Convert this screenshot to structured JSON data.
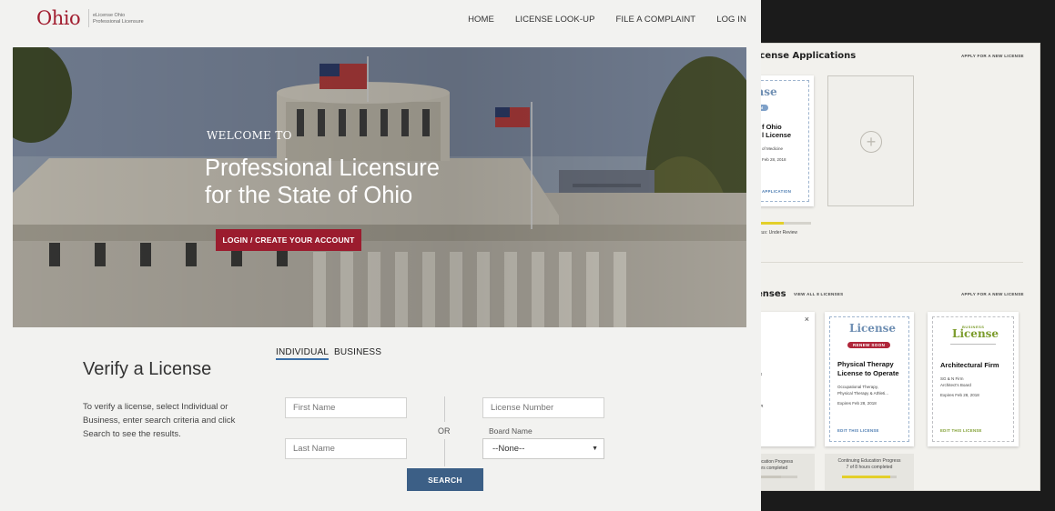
{
  "header": {
    "logo_text": "Ohio",
    "logo_sub": [
      "eLicense Ohio",
      "Professional Licensure"
    ],
    "nav": [
      "HOME",
      "LICENSE LOOK-UP",
      "FILE A COMPLAINT",
      "LOG IN"
    ]
  },
  "hero": {
    "welcome": "WELCOME TO",
    "title_line1": "Professional Licensure",
    "title_line2": "for the State of Ohio",
    "cta": "LOGIN / CREATE YOUR ACCOUNT"
  },
  "verify": {
    "title": "Verify a License",
    "description": "To verify a license, select Individual or Business, enter search criteria and click Search to see the results.",
    "tabs": [
      "INDIVIDUAL",
      "BUSINESS"
    ],
    "first_name_placeholder": "First Name",
    "last_name_placeholder": "Last Name",
    "license_number_placeholder": "License Number",
    "or": "OR",
    "board_label": "Board Name",
    "board_value": "--None--",
    "search": "SEARCH"
  },
  "dashboard": {
    "applications_title": "icense Applications",
    "apply_link": "APPLY FOR A NEW LICENSE",
    "app_card": {
      "script": "icense",
      "badge": "CATION",
      "name_lines": [
        "f Ohio",
        "l License"
      ],
      "sub": "of Medicine",
      "date": "Feb 28, 2018",
      "foot": "APPLICATION"
    },
    "status": "tatus: Under Review",
    "status_progress": 0.5,
    "licenses_title": "enses",
    "view_all": "VIEW ALL 8 LICENSES",
    "apply_link_2": "APPLY FOR A NEW LICENSE",
    "close": "×",
    "menu_items": [
      "AGEMENT",
      "CENSE",
      "NSE ADDRESS",
      "NSE EMPLOYER",
      "NT A NEW",
      "SE SUPERVISOR",
      "NSE LICENSE"
    ],
    "card2": {
      "script": "License",
      "badge": "RENEW SOON",
      "name_lines": [
        "Physical Therapy",
        "License to Operate"
      ],
      "sub_lines": [
        "Occupational Therapy,",
        "Physical Therapy & Athleti..."
      ],
      "date": "Expires Feb 28, 2018",
      "foot": "EDIT THIS LICENSE",
      "ce_title": "Continuing Education Progress",
      "ce_sub": "7 of 8 hours completed",
      "ce_progress": 0.875
    },
    "card3": {
      "small": "BUSINESS",
      "script": "License",
      "name": "Architectural Firm",
      "sub_lines": [
        "SG & N Firm",
        "Architect's Board"
      ],
      "date": "Expires Feb 28, 2018",
      "foot": "EDIT THIS LICENSE"
    },
    "ce1_title": "ducation Progress",
    "ce1_sub": "ours completed",
    "ce1_progress": 0.6
  },
  "colors": {
    "brand_red": "#a11d2f",
    "search_blue": "#3c5f86",
    "progress_yellow": "#e3cf2a"
  }
}
